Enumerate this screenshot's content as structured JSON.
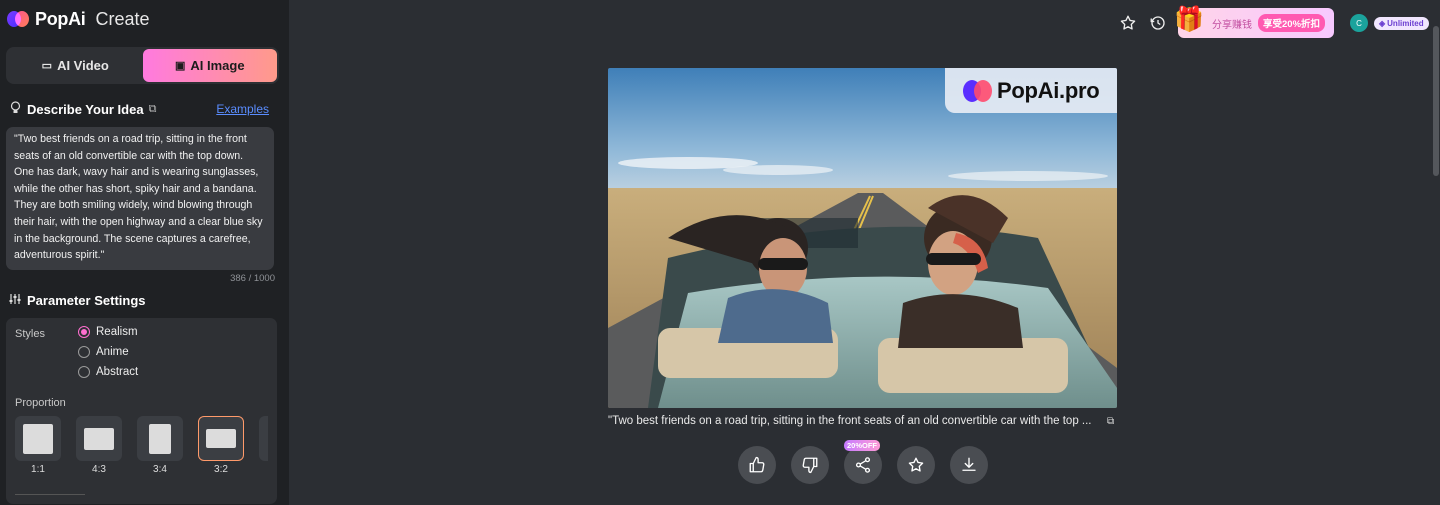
{
  "sidebar": {
    "logo_text": "PopAi",
    "app_section": "Create",
    "modes": [
      {
        "label": "AI Video",
        "icon": "video-icon",
        "active": false
      },
      {
        "label": "AI Image",
        "icon": "image-icon",
        "active": true
      }
    ],
    "describe": {
      "title": "Describe Your Idea",
      "examples_label": "Examples",
      "prompt_text": "\"Two best friends on a road trip, sitting in the front seats of an old convertible car with the top down. One has dark, wavy hair and is wearing sunglasses, while the other has short, spiky hair and a bandana. They are both smiling widely, wind blowing through their hair, with the open highway and a clear blue sky in the background. The scene captures a carefree, adventurous spirit.\"",
      "char_count": "386 / 1000"
    },
    "parameters": {
      "title": "Parameter Settings",
      "styles_label": "Styles",
      "styles": [
        {
          "label": "Realism",
          "selected": true
        },
        {
          "label": "Anime",
          "selected": false
        },
        {
          "label": "Abstract",
          "selected": false
        }
      ],
      "proportion_label": "Proportion",
      "proportions": [
        {
          "label": "1:1",
          "selected": false
        },
        {
          "label": "4:3",
          "selected": false
        },
        {
          "label": "3:4",
          "selected": false
        },
        {
          "label": "3:2",
          "selected": true
        }
      ]
    }
  },
  "topbar": {
    "promo_text_1": "分享赚钱",
    "promo_text_2": "享受20%折扣",
    "avatar_initial": "C",
    "plan_badge": "Unlimited"
  },
  "result": {
    "watermark_text": "PopAi.pro",
    "caption": "\"Two best friends on a road trip, sitting in the front seats of an old convertible car with the top ...",
    "discount_badge": "20%OFF"
  },
  "colors": {
    "accent_gradient_start": "#ff7adf",
    "accent_gradient_end": "#ff9a8a",
    "link": "#5a8dff",
    "sidebar_bg": "#1f2124",
    "main_bg": "#2b2e33"
  }
}
